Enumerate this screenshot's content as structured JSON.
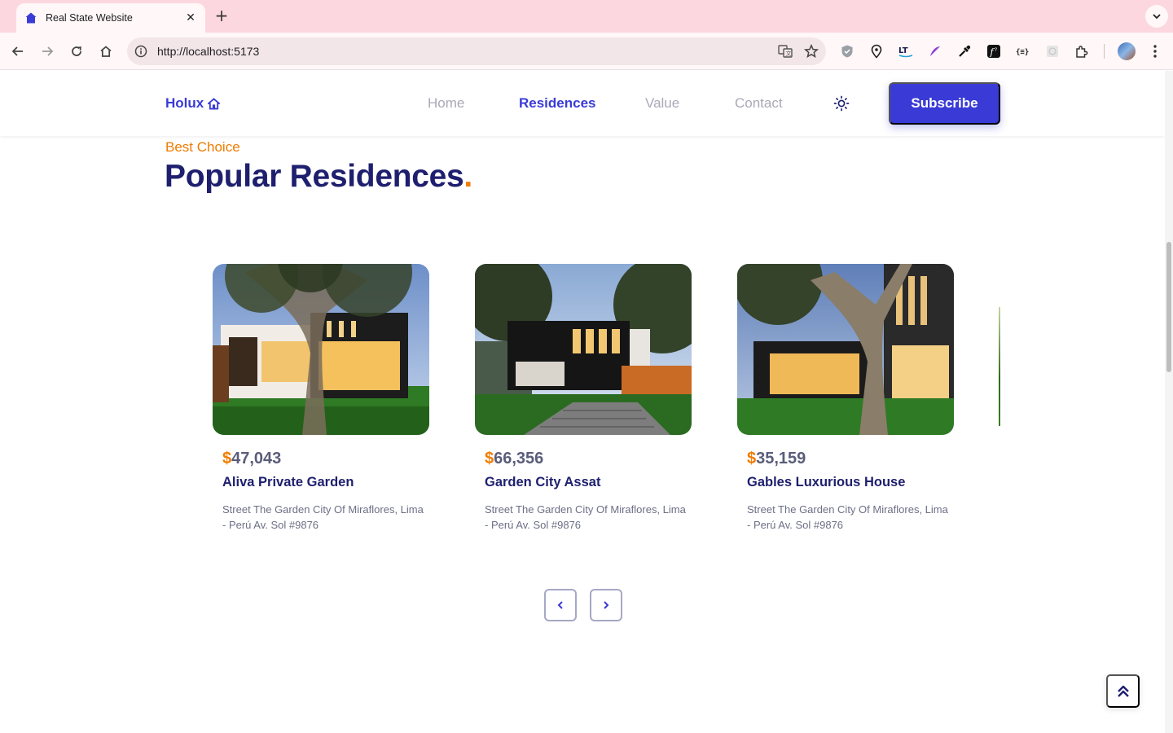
{
  "browser": {
    "tab_title": "Real State Website",
    "tab_close": "✕",
    "new_tab": "+",
    "url": "http://localhost:5173"
  },
  "nav": {
    "logo": "Holux",
    "links": [
      "Home",
      "Residences",
      "Value",
      "Contact"
    ],
    "active_link": "Residences",
    "subscribe_label": "Subscribe"
  },
  "section": {
    "subtitle": "Best Choice",
    "title": "Popular Residences",
    "title_dot": "."
  },
  "residences": [
    {
      "currency": "$",
      "price": "47,043",
      "name": "Aliva Private Garden",
      "address": "Street The Garden City Of Miraflores, Lima - Perú Av. Sol #9876"
    },
    {
      "currency": "$",
      "price": "66,356",
      "name": "Garden City Assat",
      "address": "Street The Garden City Of Miraflores, Lima - Perú Av. Sol #9876"
    },
    {
      "currency": "$",
      "price": "35,159",
      "name": "Gables Luxurious House",
      "address": "Street The Garden City Of Miraflores, Lima - Perú Av. Sol #9876"
    }
  ],
  "colors": {
    "brand": "#3a3bd6",
    "accent": "#f07c00",
    "title": "#1e1f6e",
    "tabstrip": "#fcd7df"
  },
  "icons": {
    "logo": "home-icon",
    "theme": "sun-icon",
    "prev": "chevron-left-icon",
    "next": "chevron-right-icon",
    "scroll_top": "double-chevron-up-icon"
  }
}
